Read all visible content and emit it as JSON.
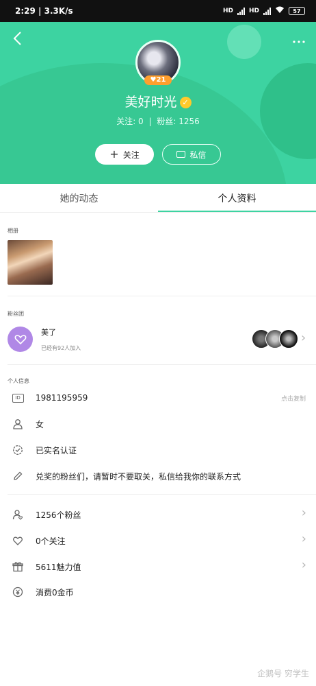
{
  "status_bar": {
    "time": "2:29",
    "speed": "3.3K/s",
    "network1": "HD",
    "network2": "HD",
    "battery": "57"
  },
  "header": {
    "back_icon": "chevron-left",
    "more_icon": "dots-horizontal"
  },
  "profile": {
    "level": "21",
    "name": "美好时光",
    "following_label": "关注: 0",
    "fans_label": "粉丝: 1256",
    "separator": "|",
    "follow_button": "关注",
    "message_button": "私信"
  },
  "tabs": [
    {
      "label": "她的动态"
    },
    {
      "label": "个人资料",
      "active": true
    }
  ],
  "album": {
    "title": "相册"
  },
  "fan_club": {
    "title": "粉丝团",
    "name": "美了",
    "joined": "已经有92人加入"
  },
  "personal_info": {
    "title": "个人信息",
    "id_badge": "ID",
    "id_value": "1981195959",
    "copy_label": "点击复制",
    "gender": "女",
    "verified": "已实名认证",
    "bio": "兑奖的粉丝们，请暂时不要取关，私信给我你的联系方式"
  },
  "stats": {
    "fans": "1256个粉丝",
    "following": "0个关注",
    "charm": "5611魅力值",
    "spent": "消费0金币"
  },
  "watermark": "企鹅号 穷学生",
  "colors": {
    "accent": "#3dd3a1",
    "fan_club": "#b088e6",
    "badge": "#ff9f2e",
    "verified": "#ffca2b"
  }
}
